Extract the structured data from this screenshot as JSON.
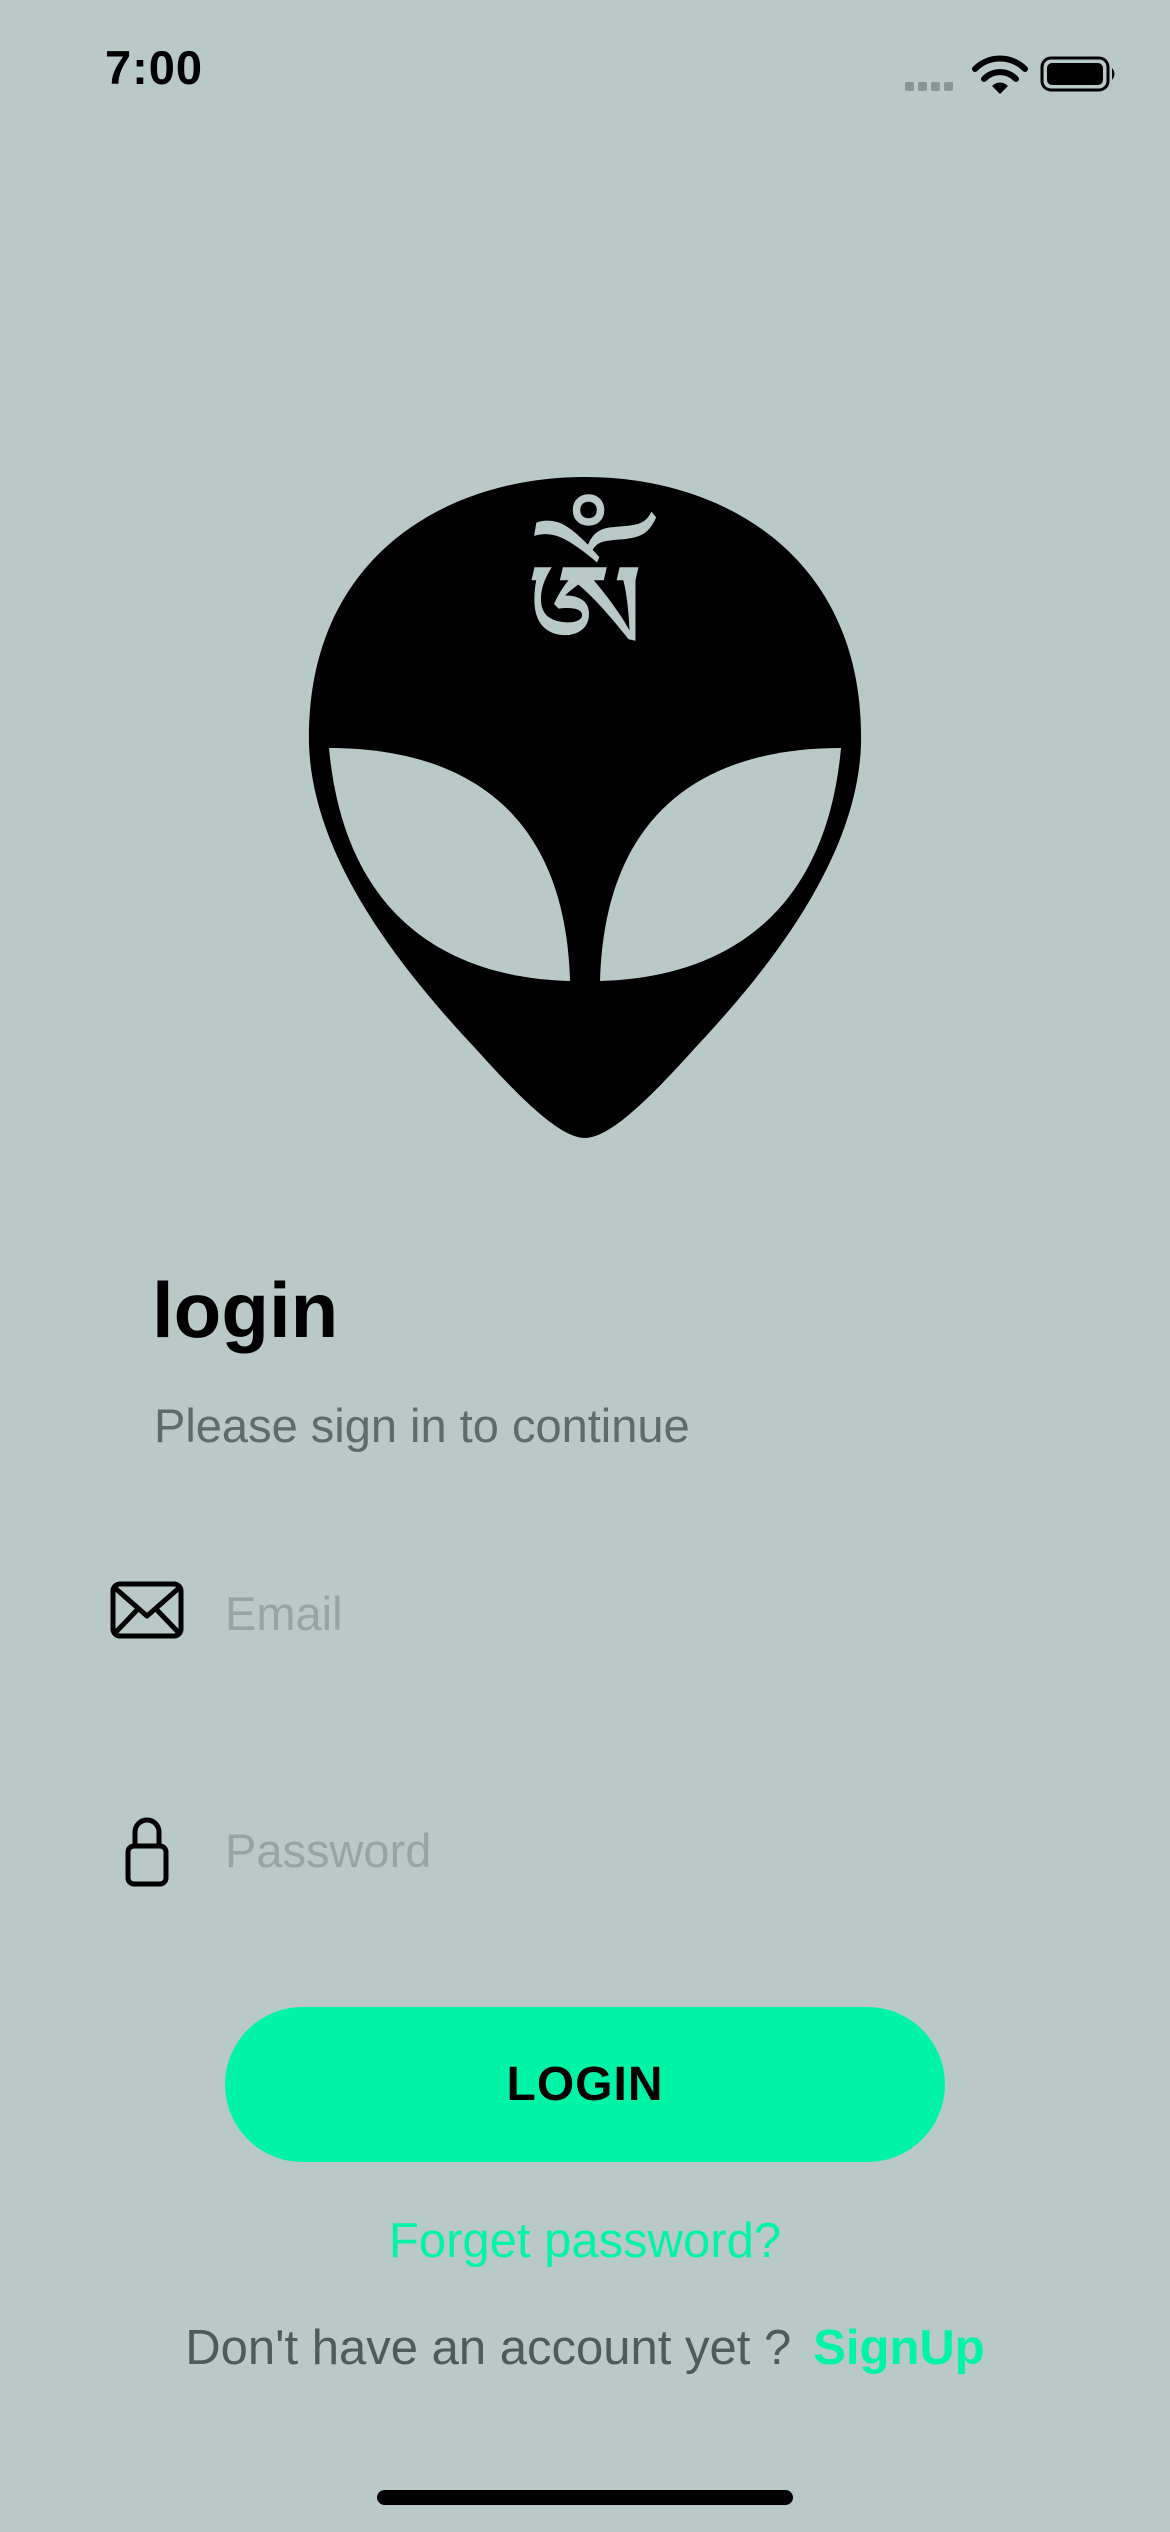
{
  "status_bar": {
    "time": "7:00",
    "icons": [
      "signal-icon",
      "wifi-icon",
      "battery-icon"
    ]
  },
  "logo": {
    "glyph": "ཨོཾ",
    "icon": "alien-head-logo"
  },
  "header": {
    "title": "login",
    "subtitle": "Please sign in to continue"
  },
  "form": {
    "email": {
      "placeholder": "Email",
      "value": "",
      "icon": "envelope-icon"
    },
    "password": {
      "placeholder": "Password",
      "value": "",
      "icon": "lock-icon"
    },
    "login_label": "LOGIN",
    "forgot_label": "Forget password?"
  },
  "footer": {
    "prompt": "Don't have an account yet ?",
    "signup_label": "SignUp"
  },
  "colors": {
    "background": "#b9c9c8",
    "accent": "#00f4a8",
    "text": "#000000",
    "muted": "#5f6a6a"
  }
}
